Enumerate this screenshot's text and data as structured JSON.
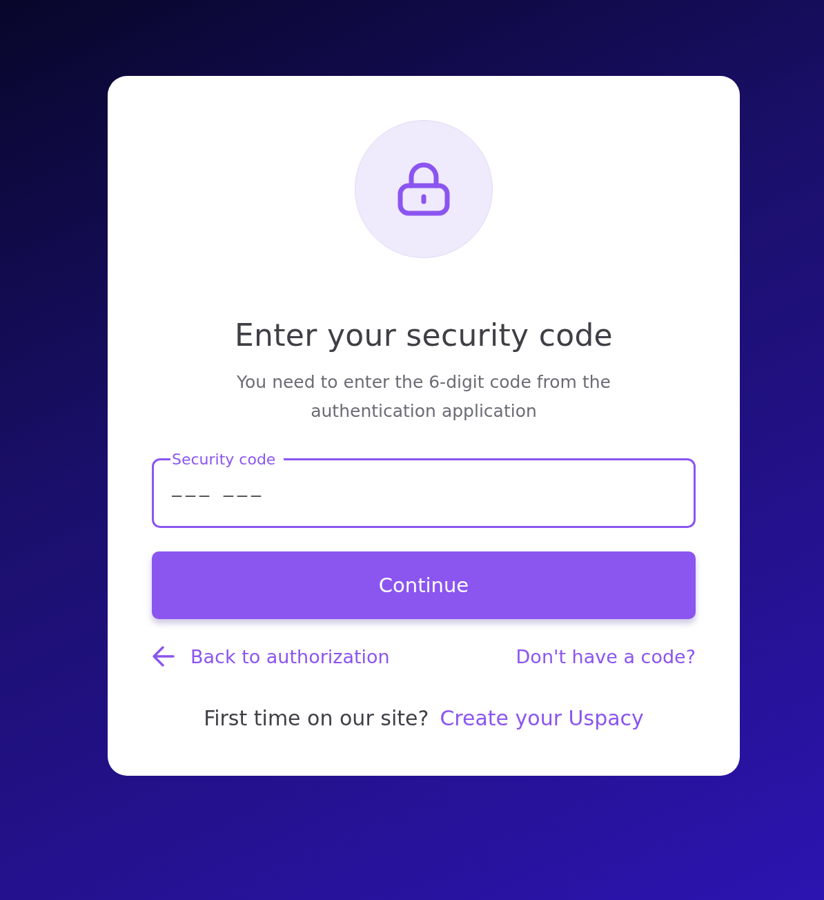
{
  "title": "Enter your security code",
  "subtitle": "You need to enter the 6-digit code from the authentication application",
  "code_field": {
    "label": "Security code",
    "placeholder": "___ ___",
    "focused": true
  },
  "continue_button": "Continue",
  "back_link": "Back to authorization",
  "help_link": "Don't have a code?",
  "signup": {
    "prompt": "First time on our site?",
    "link": "Create your Uspacy"
  }
}
